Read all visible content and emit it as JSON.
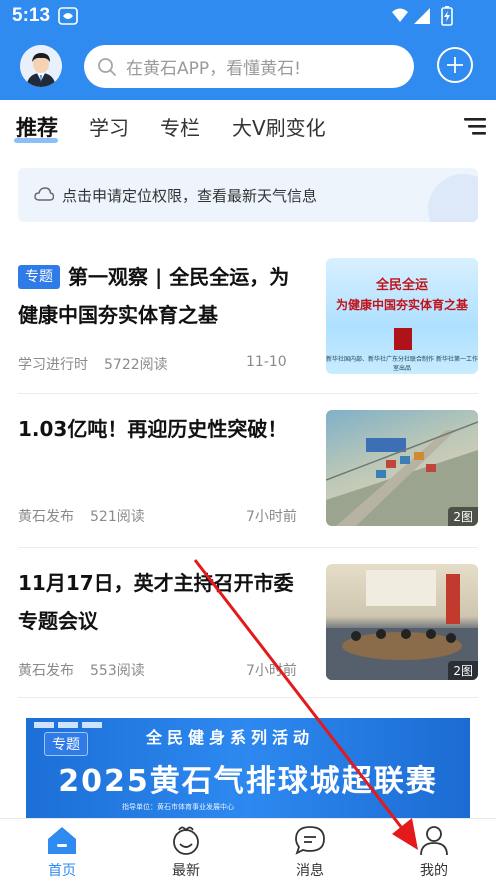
{
  "status_bar": {
    "time": "5:13"
  },
  "header": {
    "search_placeholder": "在黄石APP，看懂黄石!",
    "brand_color": "#2f8bf0"
  },
  "tabs": [
    {
      "label": "推荐",
      "active": true
    },
    {
      "label": "学习",
      "active": false
    },
    {
      "label": "专栏",
      "active": false
    },
    {
      "label": "大V刷变化",
      "active": false
    }
  ],
  "weather": {
    "text": "点击申请定位权限，查看最新天气信息"
  },
  "news": [
    {
      "tag": "专题",
      "title": "第一观察 | 全民全运，为健康中国夯实体育之基",
      "source": "学习进行时",
      "reads": "5722阅读",
      "time": "11-10",
      "thumb": {
        "line1": "全民全运",
        "line2": "为健康中国夯实体育之基",
        "seal": "第一观察",
        "footer": "新华社国内部、新华社广东分社联合制作 新华社第一工作室出品"
      }
    },
    {
      "title": "1.03亿吨！再迎历史性突破！",
      "source": "黄石发布",
      "reads": "521阅读",
      "time": "7小时前",
      "badge": "2图"
    },
    {
      "title": "11月17日，英才主持召开市委专题会议",
      "source": "黄石发布",
      "reads": "553阅读",
      "time": "7小时前",
      "badge": "2图"
    }
  ],
  "banner": {
    "tag": "专题",
    "top_text": "全民健身系列活动",
    "main_text": "2025黄石气排球城超联赛",
    "small_text": "指导单位：黄石市体育事业发展中心"
  },
  "bottom_nav": [
    {
      "label": "首页",
      "icon": "home-icon",
      "active": true
    },
    {
      "label": "最新",
      "icon": "latest-icon",
      "active": false
    },
    {
      "label": "消息",
      "icon": "message-icon",
      "active": false
    },
    {
      "label": "我的",
      "icon": "profile-icon",
      "active": false
    }
  ]
}
